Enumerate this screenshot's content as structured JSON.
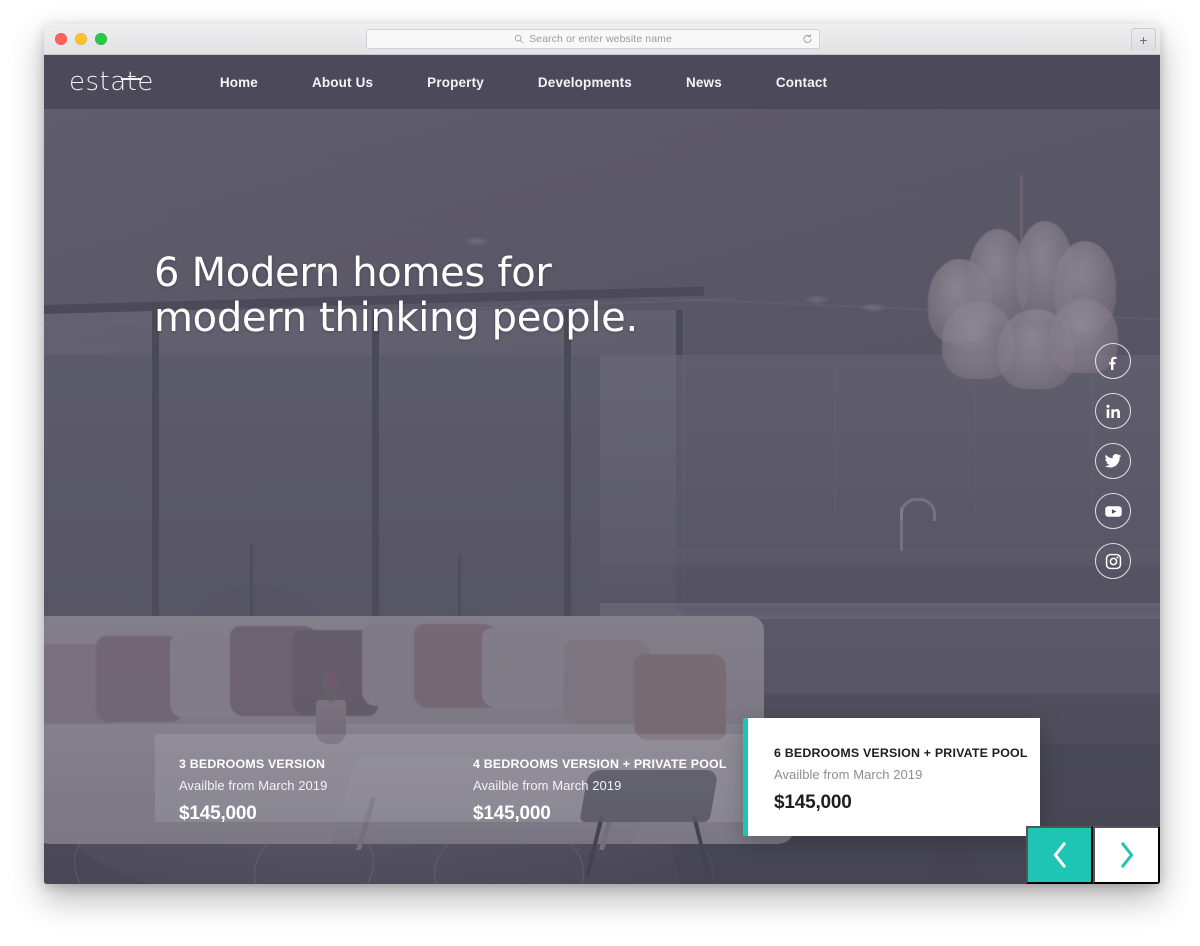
{
  "browser": {
    "traffic_lights": [
      {
        "name": "close",
        "color": "#ff6058"
      },
      {
        "name": "minimize",
        "color": "#ffc130"
      },
      {
        "name": "maximize",
        "color": "#28ca42"
      }
    ],
    "address_bar": {
      "placeholder": "Search or enter website name",
      "value": "",
      "search_icon": "search-icon",
      "reload_icon": "reload-icon"
    },
    "new_tab_label": "+"
  },
  "site": {
    "logo": "estate",
    "nav": [
      {
        "label": "Home"
      },
      {
        "label": "About Us"
      },
      {
        "label": "Property"
      },
      {
        "label": "Developments"
      },
      {
        "label": "News"
      },
      {
        "label": "Contact"
      }
    ],
    "hero": {
      "line1": "6 Modern homes for",
      "line2": "modern thinking people."
    },
    "social": [
      {
        "name": "facebook-icon",
        "label": "Facebook"
      },
      {
        "name": "linkedin-icon",
        "label": "LinkedIn"
      },
      {
        "name": "twitter-icon",
        "label": "Twitter"
      },
      {
        "name": "youtube-icon",
        "label": "YouTube"
      },
      {
        "name": "instagram-icon",
        "label": "Instagram"
      }
    ],
    "cards": [
      {
        "title": "3 BEDROOMS VERSION",
        "availability": "Availble from March 2019",
        "price": "$145,000",
        "active": false
      },
      {
        "title": "4 BEDROOMS VERSION + PRIVATE POOL",
        "availability": "Availble from March 2019",
        "price": "$145,000",
        "active": false
      },
      {
        "title": "6 BEDROOMS VERSION + PRIVATE POOL",
        "availability": "Availble from March 2019",
        "price": "$145,000",
        "active": true
      }
    ],
    "slider": {
      "prev_label": "Previous slide",
      "next_label": "Next slide"
    },
    "colors": {
      "accent": "#1ec4b4",
      "nav_background": "#4c4a5a",
      "hero_text": "#ffffff",
      "card_active_background": "#ffffff"
    }
  }
}
